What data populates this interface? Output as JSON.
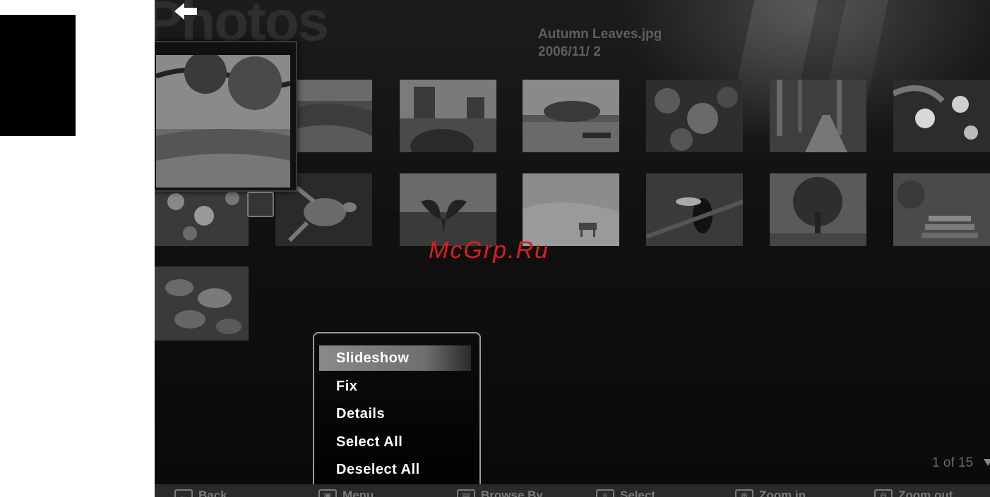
{
  "app": {
    "title": "Photos"
  },
  "current_photo": {
    "file_name": "Autumn Leaves.jpg",
    "date": "2006/11/ 2"
  },
  "watermark": "McGrp.Ru",
  "thumbnails": [
    {
      "name": "thumb-autumn-leaves",
      "selected": true
    },
    {
      "name": "thumb-meadow"
    },
    {
      "name": "thumb-desert-mesa"
    },
    {
      "name": "thumb-lake-sunset"
    },
    {
      "name": "thumb-forest-leaves"
    },
    {
      "name": "thumb-forest-path"
    },
    {
      "name": "thumb-flowers"
    },
    {
      "name": "thumb-wildflowers"
    },
    {
      "name": "thumb-sea-turtle"
    },
    {
      "name": "thumb-whale-tail"
    },
    {
      "name": "thumb-desert-oryx"
    },
    {
      "name": "thumb-toucan"
    },
    {
      "name": "thumb-tree"
    },
    {
      "name": "thumb-garden-steps"
    },
    {
      "name": "thumb-frosted-leaves"
    }
  ],
  "context_menu": {
    "items": [
      {
        "label": "Slideshow",
        "active": true
      },
      {
        "label": "Fix"
      },
      {
        "label": "Details"
      },
      {
        "label": "Select All"
      },
      {
        "label": "Deselect All"
      }
    ]
  },
  "pagination": {
    "text": "1 of 15"
  },
  "footer": {
    "items": [
      {
        "label": "Back",
        "icon": "back-arrow-icon"
      },
      {
        "label": "Menu",
        "icon": "menu-icon"
      },
      {
        "label": "Browse By",
        "icon": "browse-icon"
      },
      {
        "label": "Select",
        "icon": "select-icon"
      },
      {
        "label": "Zoom in",
        "icon": "zoom-in-icon"
      },
      {
        "label": "Zoom out",
        "icon": "zoom-out-icon"
      }
    ]
  }
}
